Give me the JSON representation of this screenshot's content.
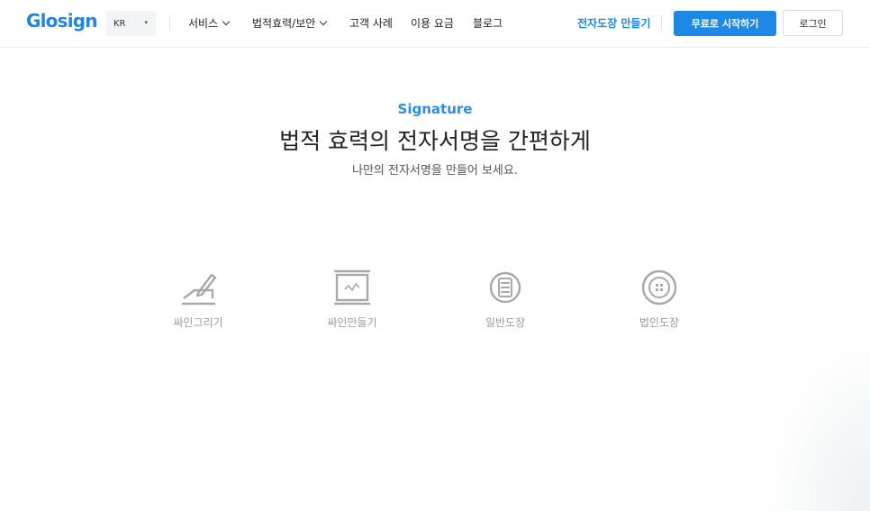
{
  "header": {
    "logo": "Glosign",
    "lang": {
      "selected": "KR",
      "caret": "▾"
    },
    "nav": [
      {
        "label": "서비스",
        "has_dropdown": true
      },
      {
        "label": "법적효력/보안",
        "has_dropdown": true
      },
      {
        "label": "고객 사례",
        "has_dropdown": false
      },
      {
        "label": "이용 요금",
        "has_dropdown": false
      },
      {
        "label": "블로그",
        "has_dropdown": false
      }
    ],
    "stamp_link": "전자도장 만들기",
    "start_button": "무료로 시작하기",
    "login_button": "로그인"
  },
  "hero": {
    "eyebrow": "Signature",
    "title": "법적 효력의 전자서명을 간편하게",
    "subtitle": "나만의 전자서명을 만들어 보세요."
  },
  "features": [
    {
      "label": "싸인그리기",
      "icon": "pen-sign-icon"
    },
    {
      "label": "싸인만들기",
      "icon": "monitor-sign-icon"
    },
    {
      "label": "일반도장",
      "icon": "oval-stamp-icon"
    },
    {
      "label": "법인도장",
      "icon": "round-stamp-icon"
    }
  ],
  "colors": {
    "brand": "#1e88e5",
    "icon_gray": "#a8a8a8",
    "label_gray": "#9a9a9a"
  }
}
